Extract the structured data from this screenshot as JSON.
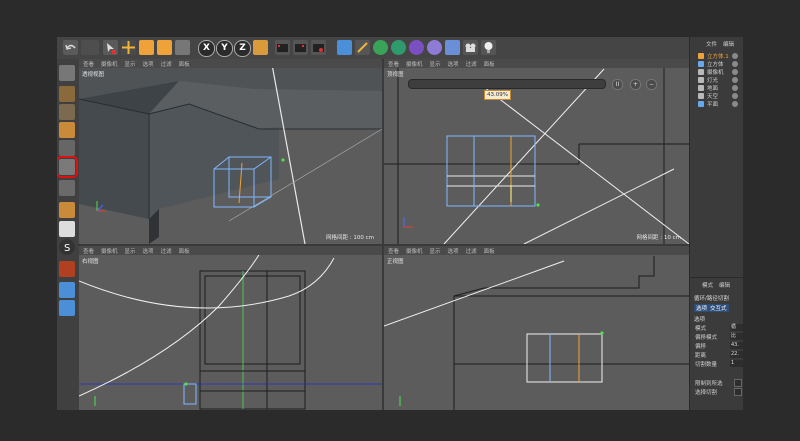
{
  "viewport_menu": [
    "查看",
    "摄像机",
    "显示",
    "选项",
    "过滤",
    "面板"
  ],
  "viewports": {
    "perspective": {
      "title": "透视视图",
      "grid": "网格间距 : 100 cm"
    },
    "top": {
      "title": "顶视图",
      "grid": "网格间距 : 10 cm"
    },
    "right": {
      "title": "右视图"
    },
    "front": {
      "title": "正视图"
    }
  },
  "zoom": {
    "value": "43.09%",
    "minus": "−",
    "plus": "+",
    "pause": "II"
  },
  "toolbar": {
    "axis_x": "X",
    "axis_y": "Y",
    "axis_z": "Z"
  },
  "object_manager": {
    "menu": [
      "文件",
      "编辑"
    ],
    "objects": [
      {
        "name": "立方体.1",
        "color": "#f0a23a",
        "active": true
      },
      {
        "name": "立方体",
        "color": "#6aa7e8",
        "active": false
      },
      {
        "name": "摄像机",
        "color": "#b9b9b9",
        "active": false
      },
      {
        "name": "灯光",
        "color": "#b9b9b9",
        "active": false
      },
      {
        "name": "地面",
        "color": "#b9b9b9",
        "active": false
      },
      {
        "name": "天空",
        "color": "#b9b9b9",
        "active": false
      },
      {
        "name": "平面",
        "color": "#6aa7e8",
        "active": false
      }
    ]
  },
  "attributes": {
    "menu": [
      "模式",
      "编辑"
    ],
    "title": "循环/路径切割",
    "tabs": [
      "选项",
      "交互式"
    ],
    "section": "选项",
    "rows": [
      {
        "label": "模式",
        "value": "循"
      },
      {
        "label": "偏移模式",
        "value": "比"
      },
      {
        "label": "偏移",
        "value": "43."
      },
      {
        "label": "距离",
        "value": "22."
      },
      {
        "label": "切割数量",
        "value": "1"
      }
    ],
    "checks": [
      "限制到所选",
      "选择切割"
    ]
  }
}
